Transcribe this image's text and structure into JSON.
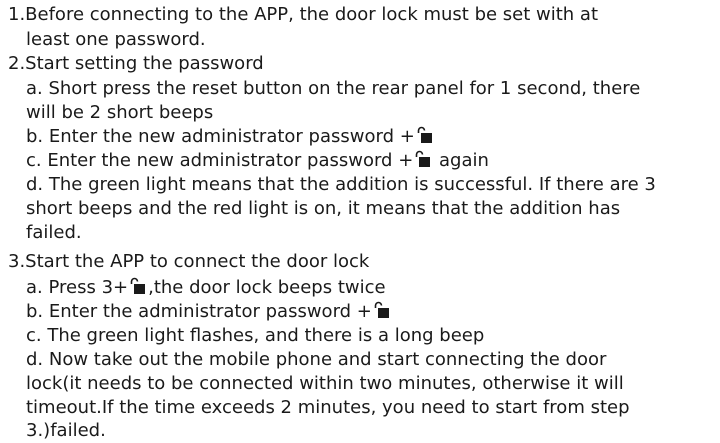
{
  "instructions": {
    "step1": {
      "line1": "1.Before connecting to the APP, the door lock must be set with at",
      "line2": "least one password."
    },
    "step2": {
      "heading": "2.Start setting the password",
      "a_line1": "a. Short press the reset button on the rear panel for 1 second, there",
      "a_line2": "will be 2 short beeps",
      "b_text": "b. Enter the new administrator password +",
      "c_text": "c. Enter the new administrator password +",
      "c_suffix": "again",
      "d_line1": "d. The green light means that the addition is successful. If there are 3",
      "d_line2": "short beeps and the red light is on, it means that the addition has",
      "d_line3": "failed."
    },
    "step3": {
      "heading": "3.Start the APP to connect the door lock",
      "a_prefix": "a. Press 3+",
      "a_suffix": ",the door lock beeps twice",
      "b_text": "b. Enter the administrator password +",
      "c_text": "c. The green light flashes, and there is a long beep",
      "d_line1": "d. Now take out the mobile phone and start connecting the door",
      "d_line2": "lock(it needs to be connected within two minutes, otherwise it will",
      "d_line3": "timeout.If the time exceeds 2 minutes, you need to start from step",
      "d_line4": "3.)failed."
    }
  },
  "icon": "unlock-key-icon"
}
